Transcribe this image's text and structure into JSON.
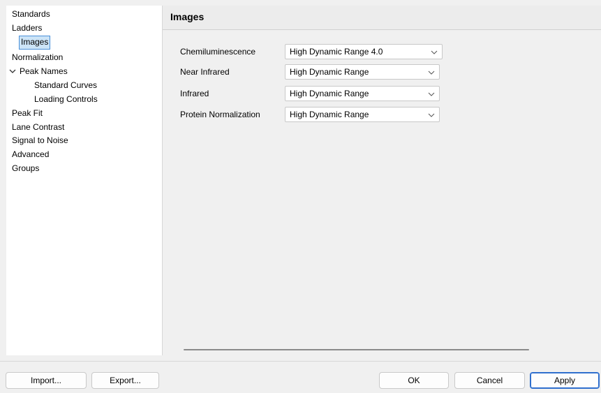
{
  "tree": {
    "items": [
      {
        "label": "Standards"
      },
      {
        "label": "Ladders"
      },
      {
        "label": "Images"
      },
      {
        "label": "Normalization"
      },
      {
        "label": "Peak Names"
      },
      {
        "label": "Standard Curves"
      },
      {
        "label": "Loading Controls"
      },
      {
        "label": "Peak Fit"
      },
      {
        "label": "Lane Contrast"
      },
      {
        "label": "Signal to Noise"
      },
      {
        "label": "Advanced"
      },
      {
        "label": "Groups"
      }
    ],
    "selected": "Images",
    "expanded": "Peak Names"
  },
  "section": {
    "title": "Images",
    "rows": [
      {
        "label": "Chemiluminescence",
        "value": "High Dynamic Range 4.0"
      },
      {
        "label": "Near Infrared",
        "value": "High Dynamic Range"
      },
      {
        "label": "Infrared",
        "value": "High Dynamic Range"
      },
      {
        "label": "Protein Normalization",
        "value": "High Dynamic Range"
      }
    ]
  },
  "buttons": {
    "import": "Import...",
    "export": "Export...",
    "ok": "OK",
    "cancel": "Cancel",
    "apply": "Apply"
  },
  "colors": {
    "selection": "#cce4f7",
    "primary_border": "#2f6fce"
  },
  "icons": {
    "expand": "chevron-down-icon",
    "dropdown": "chevron-down-icon"
  }
}
